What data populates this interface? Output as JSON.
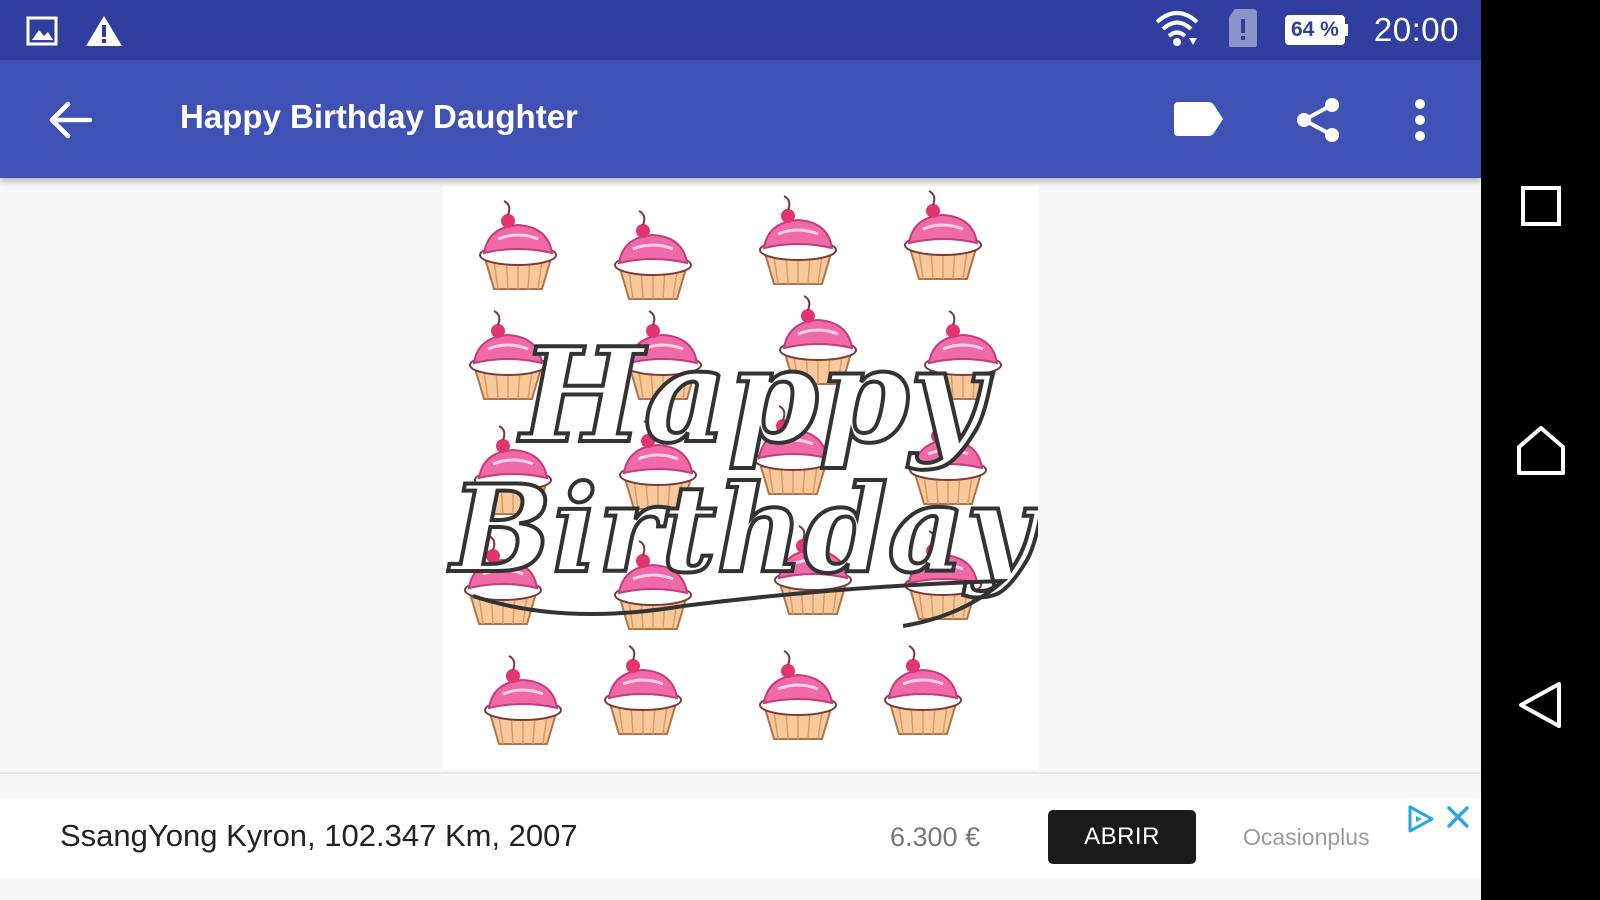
{
  "status_bar": {
    "battery_percent": "64 %",
    "time": "20:00",
    "icons": [
      "image-notification-icon",
      "warning-icon",
      "wifi-icon",
      "sim-alert-icon",
      "battery-icon"
    ]
  },
  "app_bar": {
    "title": "Happy Birthday Daughter",
    "icons": [
      "back-arrow-icon",
      "label-icon",
      "share-icon",
      "more-vert-icon"
    ],
    "color": "#3F51B5",
    "status_color": "#303F9F"
  },
  "content": {
    "image_text_line1": "Happy",
    "image_text_line2": "Birthday",
    "cupcake_icing_color": "#f06aa8",
    "cupcake_wrapper_color": "#f6c89a"
  },
  "ad": {
    "text": "SsangYong Kyron, 102.347 Km, 2007",
    "price": "6.300 €",
    "button_label": "ABRIR",
    "advertiser": "Ocasionplus",
    "icons": [
      "adchoices-icon",
      "close-icon"
    ]
  },
  "nav_bar": {
    "icons": [
      "recent-apps-icon",
      "home-icon",
      "back-icon"
    ]
  }
}
